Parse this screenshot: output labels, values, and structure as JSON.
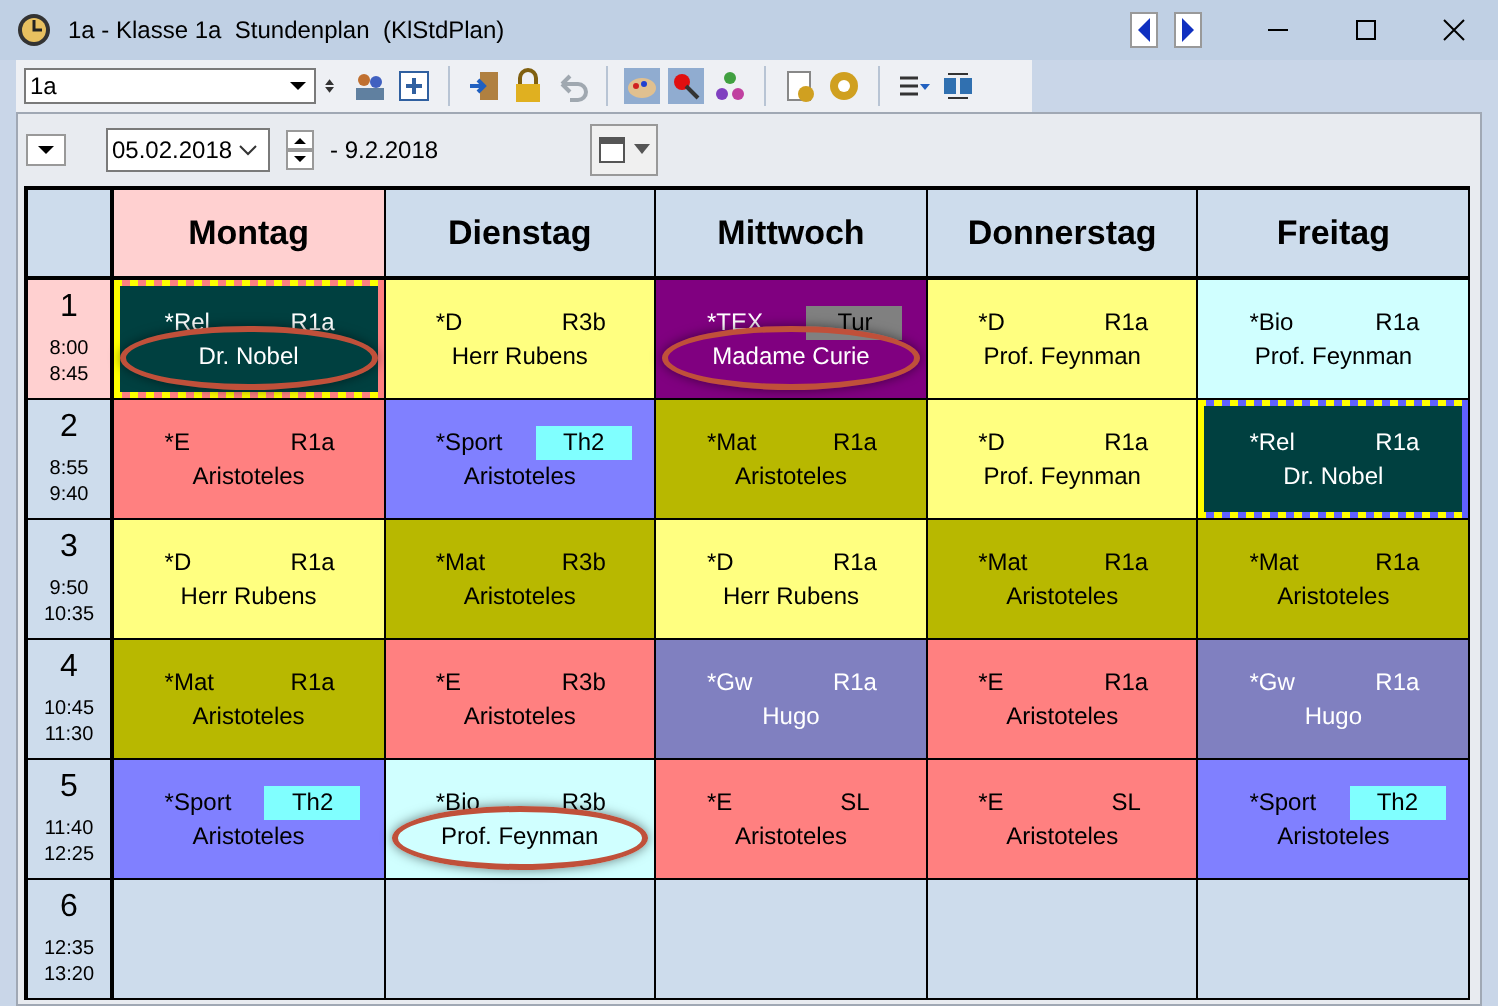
{
  "window": {
    "title": "1a - Klasse 1a  Stundenplan  (KlStdPlan)"
  },
  "toolbar": {
    "class_value": "1a"
  },
  "date_bar": {
    "date_value": "05.02.2018",
    "range": "- 9.2.2018"
  },
  "days": [
    {
      "label": "Montag",
      "selected": true
    },
    {
      "label": "Dienstag",
      "selected": false
    },
    {
      "label": "Mittwoch",
      "selected": false
    },
    {
      "label": "Donnerstag",
      "selected": false
    },
    {
      "label": "Freitag",
      "selected": false
    }
  ],
  "periods": [
    {
      "number": "1",
      "start": "8:00",
      "end": "8:45",
      "selected": true,
      "lessons": [
        {
          "kind": "lesson",
          "subject": "*Rel",
          "room": {
            "text": "R1a"
          },
          "teacher": "Dr. Nobel",
          "color": "#004040",
          "selection": {
            "color": "#ff8080"
          },
          "circled": true
        },
        {
          "kind": "lesson",
          "subject": "*D",
          "room": {
            "text": "R3b"
          },
          "teacher": "Herr Rubens",
          "color": "#ffff80",
          "circled": false
        },
        {
          "kind": "lesson",
          "subject": "*TEX",
          "room": {
            "text": "Tur",
            "color": "#808080"
          },
          "teacher": "Madame Curie",
          "color": "#800080",
          "circled": true
        },
        {
          "kind": "lesson",
          "subject": "*D",
          "room": {
            "text": "R1a"
          },
          "teacher": "Prof. Feynman",
          "color": "#ffff80",
          "circled": false
        },
        {
          "kind": "lesson",
          "subject": "*Bio",
          "room": {
            "text": "R1a"
          },
          "teacher": "Prof. Feynman",
          "color": "#d0ffff",
          "circled": false
        }
      ]
    },
    {
      "number": "2",
      "start": "8:55",
      "end": "9:40",
      "selected": false,
      "lessons": [
        {
          "kind": "lesson",
          "subject": "*E",
          "room": {
            "text": "R1a"
          },
          "teacher": "Aristoteles",
          "color": "#ff8080",
          "circled": false
        },
        {
          "kind": "lesson",
          "subject": "*Sport",
          "room": {
            "text": "Th2",
            "color": "#80ffff"
          },
          "teacher": "Aristoteles",
          "color": "#8080ff",
          "circled": false
        },
        {
          "kind": "lesson",
          "subject": "*Mat",
          "room": {
            "text": "R1a"
          },
          "teacher": "Aristoteles",
          "color": "#b8b800",
          "circled": false
        },
        {
          "kind": "lesson",
          "subject": "*D",
          "room": {
            "text": "R1a"
          },
          "teacher": "Prof. Feynman",
          "color": "#ffff80",
          "circled": false
        },
        {
          "kind": "lesson",
          "subject": "*Rel",
          "room": {
            "text": "R1a"
          },
          "teacher": "Dr. Nobel",
          "color": "#004040",
          "selection": {
            "color": "#6060ff"
          },
          "circled": false
        }
      ]
    },
    {
      "number": "3",
      "start": "9:50",
      "end": "10:35",
      "selected": false,
      "lessons": [
        {
          "kind": "lesson",
          "subject": "*D",
          "room": {
            "text": "R1a"
          },
          "teacher": "Herr Rubens",
          "color": "#ffff80",
          "circled": false
        },
        {
          "kind": "lesson",
          "subject": "*Mat",
          "room": {
            "text": "R3b"
          },
          "teacher": "Aristoteles",
          "color": "#b8b800",
          "circled": false
        },
        {
          "kind": "lesson",
          "subject": "*D",
          "room": {
            "text": "R1a"
          },
          "teacher": "Herr Rubens",
          "color": "#ffff80",
          "circled": false
        },
        {
          "kind": "lesson",
          "subject": "*Mat",
          "room": {
            "text": "R1a"
          },
          "teacher": "Aristoteles",
          "color": "#b8b800",
          "circled": false
        },
        {
          "kind": "lesson",
          "subject": "*Mat",
          "room": {
            "text": "R1a"
          },
          "teacher": "Aristoteles",
          "color": "#b8b800",
          "circled": false
        }
      ]
    },
    {
      "number": "4",
      "start": "10:45",
      "end": "11:30",
      "selected": false,
      "lessons": [
        {
          "kind": "lesson",
          "subject": "*Mat",
          "room": {
            "text": "R1a"
          },
          "teacher": "Aristoteles",
          "color": "#b8b800",
          "circled": false
        },
        {
          "kind": "lesson",
          "subject": "*E",
          "room": {
            "text": "R3b"
          },
          "teacher": "Aristoteles",
          "color": "#ff8080",
          "circled": false
        },
        {
          "kind": "lesson",
          "subject": "*Gw",
          "room": {
            "text": "R1a"
          },
          "teacher": "Hugo",
          "color": "#8080c0",
          "circled": false
        },
        {
          "kind": "lesson",
          "subject": "*E",
          "room": {
            "text": "R1a"
          },
          "teacher": "Aristoteles",
          "color": "#ff8080",
          "circled": false
        },
        {
          "kind": "lesson",
          "subject": "*Gw",
          "room": {
            "text": "R1a"
          },
          "teacher": "Hugo",
          "color": "#8080c0",
          "circled": false
        }
      ]
    },
    {
      "number": "5",
      "start": "11:40",
      "end": "12:25",
      "selected": false,
      "lessons": [
        {
          "kind": "lesson",
          "subject": "*Sport",
          "room": {
            "text": "Th2",
            "color": "#80ffff"
          },
          "teacher": "Aristoteles",
          "color": "#8080ff",
          "circled": false
        },
        {
          "kind": "lesson",
          "subject": "*Bio",
          "room": {
            "text": "R3b"
          },
          "teacher": "Prof. Feynman",
          "color": "#d0ffff",
          "circled": true
        },
        {
          "kind": "lesson",
          "subject": "*E",
          "room": {
            "text": "SL"
          },
          "teacher": "Aristoteles",
          "color": "#ff8080",
          "circled": false
        },
        {
          "kind": "lesson",
          "subject": "*E",
          "room": {
            "text": "SL"
          },
          "teacher": "Aristoteles",
          "color": "#ff8080",
          "circled": false
        },
        {
          "kind": "lesson",
          "subject": "*Sport",
          "room": {
            "text": "Th2",
            "color": "#80ffff"
          },
          "teacher": "Aristoteles",
          "color": "#8080ff",
          "circled": false
        }
      ]
    },
    {
      "number": "6",
      "start": "12:35",
      "end": "13:20",
      "selected": false,
      "lessons": [
        {
          "kind": "empty"
        },
        {
          "kind": "empty"
        },
        {
          "kind": "empty"
        },
        {
          "kind": "empty"
        },
        {
          "kind": "empty"
        }
      ]
    }
  ]
}
